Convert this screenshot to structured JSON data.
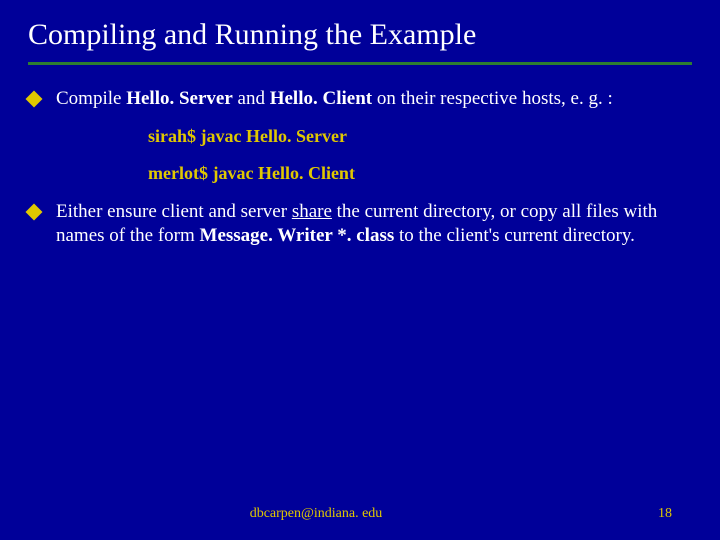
{
  "title": "Compiling and Running the Example",
  "bullets": [
    {
      "pre": "Compile ",
      "b1": "Hello. Server",
      "mid": " and ",
      "b2": "Hello. Client",
      "post": " on their respective hosts, e. g. :"
    },
    {
      "pre": "Either ensure client and server ",
      "u1": "share",
      "mid": " the current directory, or copy all files with names of the form ",
      "b1": "Message. Writer *. class",
      "post": " to the client's current directory."
    }
  ],
  "code": {
    "line1": "sirah$  javac Hello. Server",
    "line2": "merlot$  javac Hello. Client"
  },
  "footer": {
    "email": "dbcarpen@indiana. edu",
    "page": "18"
  }
}
